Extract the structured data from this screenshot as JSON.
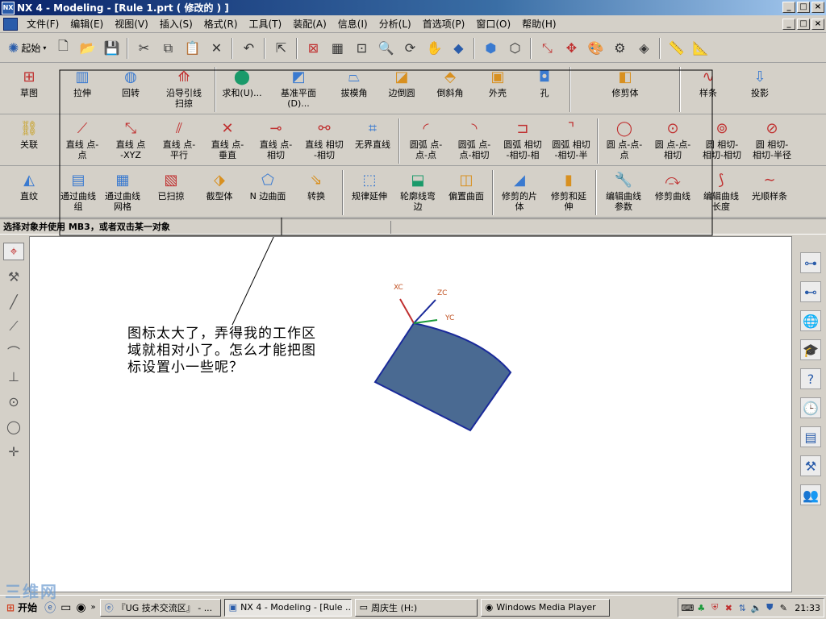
{
  "window": {
    "title": "NX 4 - Modeling - [Rule 1.prt ( 修改的 ) ]",
    "min": "_",
    "max": "□",
    "close": "×"
  },
  "menu": [
    "文件(F)",
    "编辑(E)",
    "视图(V)",
    "插入(S)",
    "格式(R)",
    "工具(T)",
    "装配(A)",
    "信息(I)",
    "分析(L)",
    "首选项(P)",
    "窗口(O)",
    "帮助(H)"
  ],
  "toolbar": {
    "start_label": "起始"
  },
  "ribbon1": [
    {
      "label": "草图",
      "icon": "sketch-icon"
    },
    {
      "label": "拉伸",
      "icon": "extrude-icon"
    },
    {
      "label": "回转",
      "icon": "revolve-icon"
    },
    {
      "label": "沿导引线\n扫掠",
      "icon": "sweep-icon"
    },
    {
      "label": "求和(U)...",
      "icon": "unite-icon"
    },
    {
      "label": "基准平面\n(D)...",
      "icon": "datum-plane-icon"
    },
    {
      "label": "拔模角",
      "icon": "draft-icon"
    },
    {
      "label": "边倒圆",
      "icon": "edge-blend-icon"
    },
    {
      "label": "倒斜角",
      "icon": "chamfer-icon"
    },
    {
      "label": "外壳",
      "icon": "shell-icon"
    },
    {
      "label": "孔",
      "icon": "hole-icon"
    },
    {
      "label": "修剪体",
      "icon": "trim-body-icon"
    },
    {
      "label": "样条",
      "icon": "spline-icon"
    },
    {
      "label": "投影",
      "icon": "project-icon"
    }
  ],
  "ribbon2": [
    {
      "label": "关联",
      "icon": "associative-icon"
    },
    {
      "label": "直线 点-\n点",
      "icon": "line-point-point-icon"
    },
    {
      "label": "直线 点\n-XYZ",
      "icon": "line-point-xyz-icon"
    },
    {
      "label": "直线 点-\n平行",
      "icon": "line-point-parallel-icon"
    },
    {
      "label": "直线 点-\n垂直",
      "icon": "line-point-perpendicular-icon"
    },
    {
      "label": "直线 点-\n相切",
      "icon": "line-point-tangent-icon"
    },
    {
      "label": "直线 相切\n-相切",
      "icon": "line-tangent-tangent-icon"
    },
    {
      "label": "无界直线",
      "icon": "unbounded-line-icon"
    },
    {
      "label": "圆弧 点-\n点-点",
      "icon": "arc-point-point-point-icon"
    },
    {
      "label": "圆弧 点-\n点-相切",
      "icon": "arc-point-point-tangent-icon"
    },
    {
      "label": "圆弧 相切\n-相切-相",
      "icon": "arc-tangent-tangent-icon"
    },
    {
      "label": "圆弧 相切\n-相切-半",
      "icon": "arc-tangent-radius-icon"
    },
    {
      "label": "圆 点-点-\n点",
      "icon": "circle-point-point-point-icon"
    },
    {
      "label": "圆 点-点-\n相切",
      "icon": "circle-point-point-tangent-icon"
    },
    {
      "label": "圆 相切-\n相切-相切",
      "icon": "circle-tangent-tangent-icon"
    },
    {
      "label": "圆 相切-\n相切-半径",
      "icon": "circle-tangent-radius-icon"
    }
  ],
  "ribbon3": [
    {
      "label": "直纹",
      "icon": "ruled-surface-icon"
    },
    {
      "label": "通过曲线\n组",
      "icon": "through-curves-icon"
    },
    {
      "label": "通过曲线\n网格",
      "icon": "through-curve-mesh-icon"
    },
    {
      "label": "已扫掠",
      "icon": "swept-icon"
    },
    {
      "label": "截型体",
      "icon": "section-body-icon"
    },
    {
      "label": "N 边曲面",
      "icon": "n-sided-surface-icon"
    },
    {
      "label": "转换",
      "icon": "transform-icon"
    },
    {
      "label": "规律延伸",
      "icon": "law-extension-icon"
    },
    {
      "label": "轮廓线弯\n边",
      "icon": "silhouette-flange-icon"
    },
    {
      "label": "偏置曲面",
      "icon": "offset-surface-icon"
    },
    {
      "label": "修剪的片\n体",
      "icon": "trimmed-sheet-icon"
    },
    {
      "label": "修剪和延\n伸",
      "icon": "trim-extend-icon"
    },
    {
      "label": "编辑曲线\n参数",
      "icon": "edit-curve-params-icon"
    },
    {
      "label": "修剪曲线",
      "icon": "trim-curve-icon"
    },
    {
      "label": "编辑曲线\n长度",
      "icon": "edit-curve-length-icon"
    },
    {
      "label": "光顺样条",
      "icon": "smooth-spline-icon"
    }
  ],
  "status": {
    "prompt": "选择对象并使用 MB3，或者双击某一对象"
  },
  "viewport": {
    "axis_x": "XC",
    "axis_y": "YC",
    "axis_z": "ZC",
    "face_color": "#4a6a92",
    "edge_color": "#1a2a9a"
  },
  "annotation": {
    "text": "图标太大了，弄得我的工作区域就相对小了。怎么才能把图标设置小一些呢？"
  },
  "taskbar": {
    "start": "开始",
    "tasks": [
      "『UG 技术交流区』 - ...",
      "NX 4 - Modeling - [Rule ...",
      "周庆生 (H:)",
      "Windows Media Player"
    ],
    "clock": "21:33"
  },
  "watermark": "三维网"
}
